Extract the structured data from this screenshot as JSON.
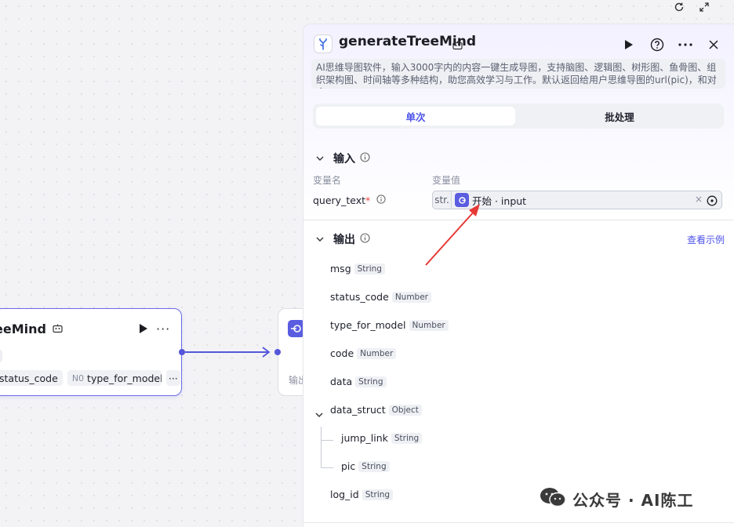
{
  "canvas": {
    "node": {
      "title_fragment": "eeMind",
      "tag1": "status_code",
      "tag2_type": "N0",
      "tag2": "type_for_model",
      "more": "···"
    },
    "node2": {
      "output_label": "输出"
    }
  },
  "panel": {
    "title": "generateTreeMind",
    "description": "AI思维导图软件，输入3000字内的内容一键生成导图，支持脑图、逻辑图、树形图、鱼骨图、组织架构图、时间轴等多种结构，助您高效学习与工作。默认返回给用户思维导图的url(pic)，和对应…",
    "tabs": [
      {
        "label": "单次",
        "active": true
      },
      {
        "label": "批处理",
        "active": false
      }
    ],
    "input": {
      "section_label": "输入",
      "col_name": "变量名",
      "col_value": "变量值",
      "var_name": "query_text",
      "required_mark": "*",
      "type_prefix": "str.",
      "ref_path": "开始 · input",
      "clear": "×"
    },
    "output": {
      "section_label": "输出",
      "example_link": "查看示例",
      "fields": [
        {
          "name": "msg",
          "type": "String"
        },
        {
          "name": "status_code",
          "type": "Number"
        },
        {
          "name": "type_for_model",
          "type": "Number"
        },
        {
          "name": "code",
          "type": "Number"
        },
        {
          "name": "data",
          "type": "String"
        },
        {
          "name": "data_struct",
          "type": "Object"
        },
        {
          "name": "jump_link",
          "type": "String"
        },
        {
          "name": "pic",
          "type": "String"
        },
        {
          "name": "log_id",
          "type": "String"
        }
      ]
    }
  },
  "watermark": "公众号 · AI陈工",
  "colors": {
    "accent": "#4d53e8",
    "edge": "#5556d8",
    "annotation": "#e53935"
  }
}
